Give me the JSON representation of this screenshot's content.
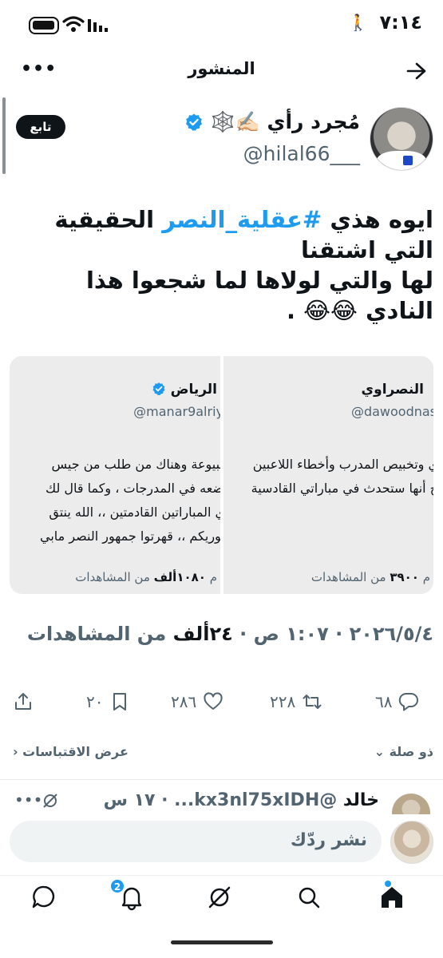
{
  "status_bar": {
    "time": "٧:١٤"
  },
  "header": {
    "title": "المنشور",
    "more": "•••"
  },
  "post": {
    "author": {
      "name": "مُجرد رأي ✍🏻🕸️",
      "handle": "@hilal66___",
      "follow_label": "تابع"
    },
    "text": {
      "line1_prefix": "ايوه هذي ",
      "hashtag": "#عقلية_النصر",
      "line1_suffix": " الحقيقية التي اشتقنا",
      "line2": "لها والتي لولاها لما شجعوا هذا النادي 😂😂 ."
    },
    "images": {
      "left": {
        "name": "الرياض",
        "handle": "@manar9alriy",
        "lines": [
          "مبيوعة وهناك من طلب من جيس",
          "ضعه في المدرجات ، وكما قال لك",
          "ي المباراتين  القادمتين ،، الله ينتق",
          "ـوريكم ،، قهرتوا جمهور النصر مابي"
        ],
        "views_prefix": "م ",
        "views_count": "١٠٨٠ألف",
        "views_suffix": " من المشاهدات"
      },
      "right": {
        "name": "النصراوي",
        "handle": "@dawoodnas",
        "lines": [
          "ي وتخبيص المدرب وأخطاء اللاعبين",
          "ج أنها ستحدث في مباراتي القادسية"
        ],
        "views_prefix": "م ",
        "views_count": "٣٩٠٠",
        "views_suffix": " من المشاهدات"
      }
    },
    "meta": {
      "datetime": "٢٠٢٦/٥/٤ · ١:٠٧ ص · ",
      "views": "٢٤ألف",
      "views_suffix": " من المشاهدات"
    },
    "actions": {
      "replies": "٦٨",
      "reposts": "٢٢٨",
      "likes": "٢٨٦",
      "bookmarks": "٢٠"
    },
    "related_label": "ذو صلة",
    "quotes_label": "عرض الاقتباسات"
  },
  "reply_preview": {
    "name": "خالد",
    "handle": "@kx3nl75xIDH...",
    "time": "١٧ س"
  },
  "reply_box": {
    "placeholder": "نشر ردّك"
  },
  "nav": {
    "notifications_badge": "2"
  },
  "colors": {
    "accent": "#1d9bf0",
    "text": "#0f1419",
    "secondary": "#536471"
  }
}
